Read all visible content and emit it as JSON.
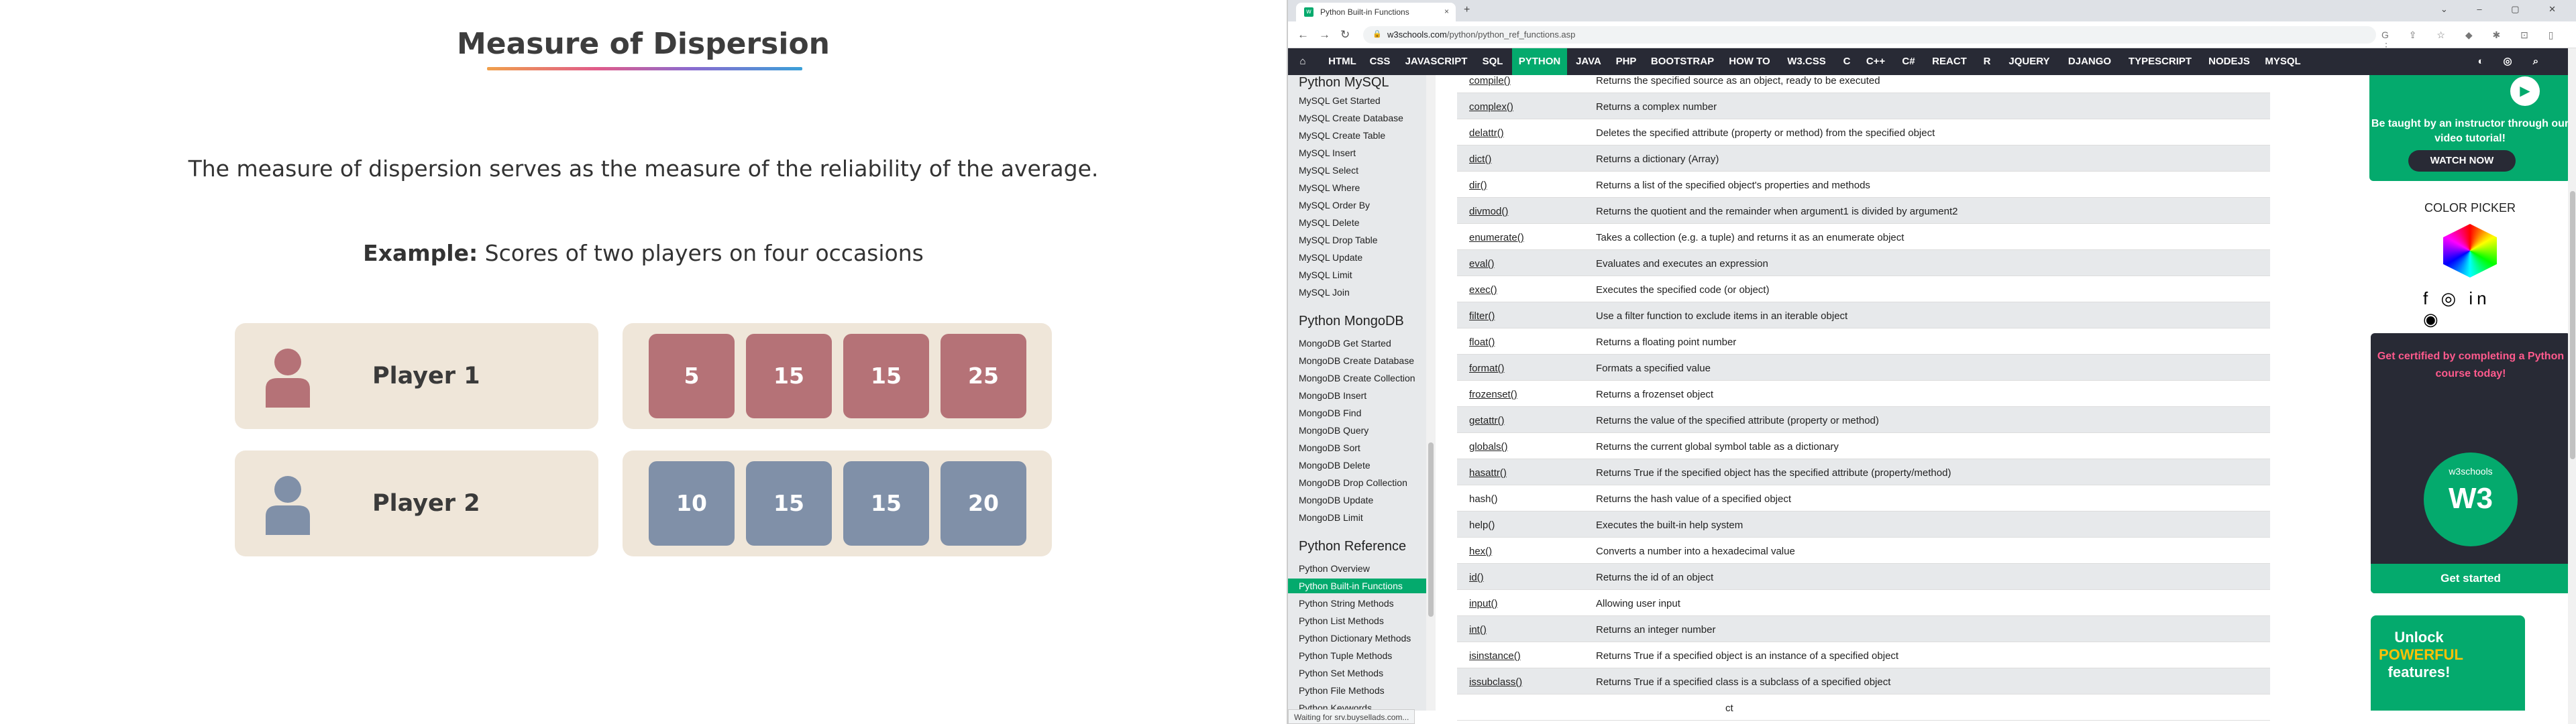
{
  "left": {
    "title": "Measure of Dispersion",
    "description": "The measure of dispersion serves as the measure of the reliability of the average.",
    "example_label": "Example:",
    "example_text": "Scores of two players on four occasions",
    "players": [
      {
        "name": "Player 1",
        "scores": [
          "5",
          "15",
          "15",
          "25"
        ],
        "color": "#b57277"
      },
      {
        "name": "Player 2",
        "scores": [
          "10",
          "15",
          "15",
          "20"
        ],
        "color": "#8090a8"
      }
    ]
  },
  "browser": {
    "tab_title": "Python Built-in Functions",
    "tab_close": "×",
    "new_tab": "+",
    "window_buttons": "⌄ – ▢ ✕",
    "back": "←",
    "forward": "→",
    "reload": "↻",
    "url_host": "w3schools.com",
    "url_path": "/python/python_ref_functions.asp",
    "status_text": "Waiting for srv.buysellads.com...",
    "nav": [
      "HTML",
      "CSS",
      "JAVASCRIPT",
      "SQL",
      "PYTHON",
      "JAVA",
      "PHP",
      "BOOTSTRAP",
      "HOW TO",
      "W3.CSS",
      "C",
      "C++",
      "C#",
      "REACT",
      "R",
      "JQUERY",
      "DJANGO",
      "TYPESCRIPT",
      "NODEJS",
      "MYSQL"
    ],
    "nav_active": "PYTHON",
    "sidebar": {
      "mysql_heading": "Python MySQL",
      "mysql_items": [
        "MySQL Get Started",
        "MySQL Create Database",
        "MySQL Create Table",
        "MySQL Insert",
        "MySQL Select",
        "MySQL Where",
        "MySQL Order By",
        "MySQL Delete",
        "MySQL Drop Table",
        "MySQL Update",
        "MySQL Limit",
        "MySQL Join"
      ],
      "mongo_heading": "Python MongoDB",
      "mongo_items": [
        "MongoDB Get Started",
        "MongoDB Create Database",
        "MongoDB Create Collection",
        "MongoDB Insert",
        "MongoDB Find",
        "MongoDB Query",
        "MongoDB Sort",
        "MongoDB Delete",
        "MongoDB Drop Collection",
        "MongoDB Update",
        "MongoDB Limit"
      ],
      "ref_heading": "Python Reference",
      "ref_items": [
        "Python Overview",
        "Python Built-in Functions",
        "Python String Methods",
        "Python List Methods",
        "Python Dictionary Methods",
        "Python Tuple Methods",
        "Python Set Methods",
        "Python File Methods",
        "Python Keywords"
      ],
      "ref_selected": "Python Built-in Functions"
    },
    "functions": [
      {
        "name": "compile()",
        "desc": "Returns the specified source as an object, ready to be executed"
      },
      {
        "name": "complex()",
        "desc": "Returns a complex number"
      },
      {
        "name": "delattr()",
        "desc": "Deletes the specified attribute (property or method) from the specified object"
      },
      {
        "name": "dict()",
        "desc": "Returns a dictionary (Array)"
      },
      {
        "name": "dir()",
        "desc": "Returns a list of the specified object's properties and methods"
      },
      {
        "name": "divmod()",
        "desc": "Returns the quotient and the remainder when argument1 is divided by argument2"
      },
      {
        "name": "enumerate()",
        "desc": "Takes a collection (e.g. a tuple) and returns it as an enumerate object"
      },
      {
        "name": "eval()",
        "desc": "Evaluates and executes an expression"
      },
      {
        "name": "exec()",
        "desc": "Executes the specified code (or object)"
      },
      {
        "name": "filter()",
        "desc": "Use a filter function to exclude items in an iterable object"
      },
      {
        "name": "float()",
        "desc": "Returns a floating point number"
      },
      {
        "name": "format()",
        "desc": "Formats a specified value"
      },
      {
        "name": "frozenset()",
        "desc": "Returns a frozenset object"
      },
      {
        "name": "getattr()",
        "desc": "Returns the value of the specified attribute (property or method)"
      },
      {
        "name": "globals()",
        "desc": "Returns the current global symbol table as a dictionary"
      },
      {
        "name": "hasattr()",
        "desc": "Returns True if the specified object has the specified attribute (property/method)"
      },
      {
        "name": "hash()",
        "desc": "Returns the hash value of a specified object"
      },
      {
        "name": "help()",
        "desc": "Executes the built-in help system"
      },
      {
        "name": "hex()",
        "desc": "Converts a number into a hexadecimal value"
      },
      {
        "name": "id()",
        "desc": "Returns the id of an object"
      },
      {
        "name": "input()",
        "desc": "Allowing user input"
      },
      {
        "name": "int()",
        "desc": "Returns an integer number"
      },
      {
        "name": "isinstance()",
        "desc": "Returns True if a specified object is an instance of a specified object"
      },
      {
        "name": "issubclass()",
        "desc": "Returns True if a specified class is a subclass of a specified object"
      },
      {
        "name": "",
        "desc": "ct"
      }
    ],
    "promo": {
      "tagline": "Be taught by an instructor through our video tutorial!",
      "button": "WATCH NOW",
      "play": "▶",
      "color_picker": "COLOR PICKER",
      "social": "f ◎ in ◉",
      "cert_text": "Get certified by completing a Python course today!",
      "badge_top": "w3schools",
      "badge_logo": "W3",
      "cert_button": "Get started",
      "unlock_line1": "Unlock",
      "unlock_line2": "POWERFUL",
      "unlock_line3": "features!"
    }
  }
}
